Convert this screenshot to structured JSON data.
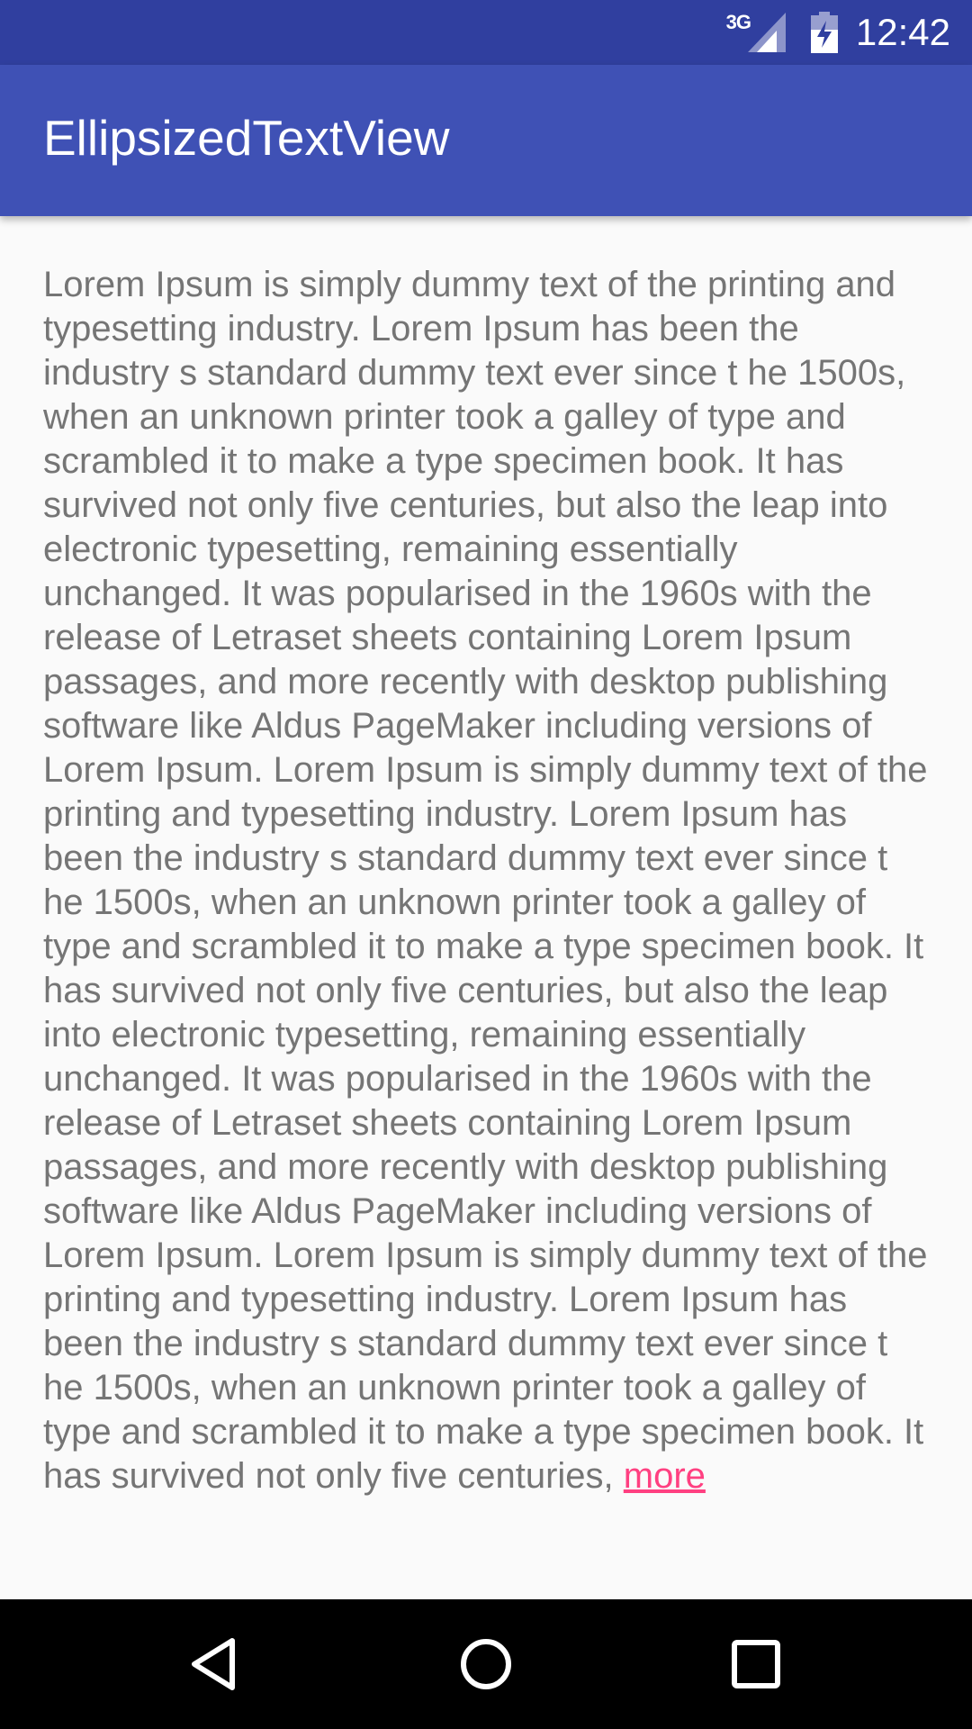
{
  "status_bar": {
    "network_type": "3G",
    "time": "12:42",
    "icons": [
      "signal-icon",
      "battery-icon"
    ]
  },
  "app_bar": {
    "title": "EllipsizedTextView"
  },
  "content": {
    "text": "Lorem Ipsum is simply dummy text of the printing and typesetting industry. Lorem Ipsum has been the industry s standard dummy text ever since t he 1500s, when an unknown printer took a galley of type and scrambled it to make a type specimen book. It has survived not only five centuries, but also the leap into electronic typesetting, remaining essentially unchanged. It was popularised in the 1960s with the release of Letraset sheets containing Lorem Ipsum passages, and more recently with desktop publishing software like Aldus PageMaker including versions of Lorem Ipsum. Lorem Ipsum is simply dummy text of the printing and typesetting industry. Lorem Ipsum has been the industry s standard dummy text ever since t he 1500s, when an unknown printer took a galley of type and scrambled it to make a type specimen book. It has survived not only five centuries, but also the leap into electronic typesetting, remaining essentially unchanged. It was popularised in the 1960s with the release of Letraset sheets containing Lorem Ipsum passages, and more recently with desktop publishing software like Aldus PageMaker including versions of Lorem Ipsum. Lorem Ipsum is simply dummy text of the printing and typesetting industry. Lorem Ipsum has been the industry s standard dummy text ever since t he 1500s, when an unknown printer took a galley of type and scrambled it to make a type specimen book. It has survived not only five centuries, ",
    "more_label": "more"
  },
  "nav_bar": {
    "icons": [
      "back-icon",
      "home-icon",
      "recents-icon"
    ]
  },
  "colors": {
    "status_bar": "#303f9f",
    "app_bar": "#3f51b5",
    "text": "#757575",
    "accent": "#ff4081",
    "background": "#fafafa"
  }
}
